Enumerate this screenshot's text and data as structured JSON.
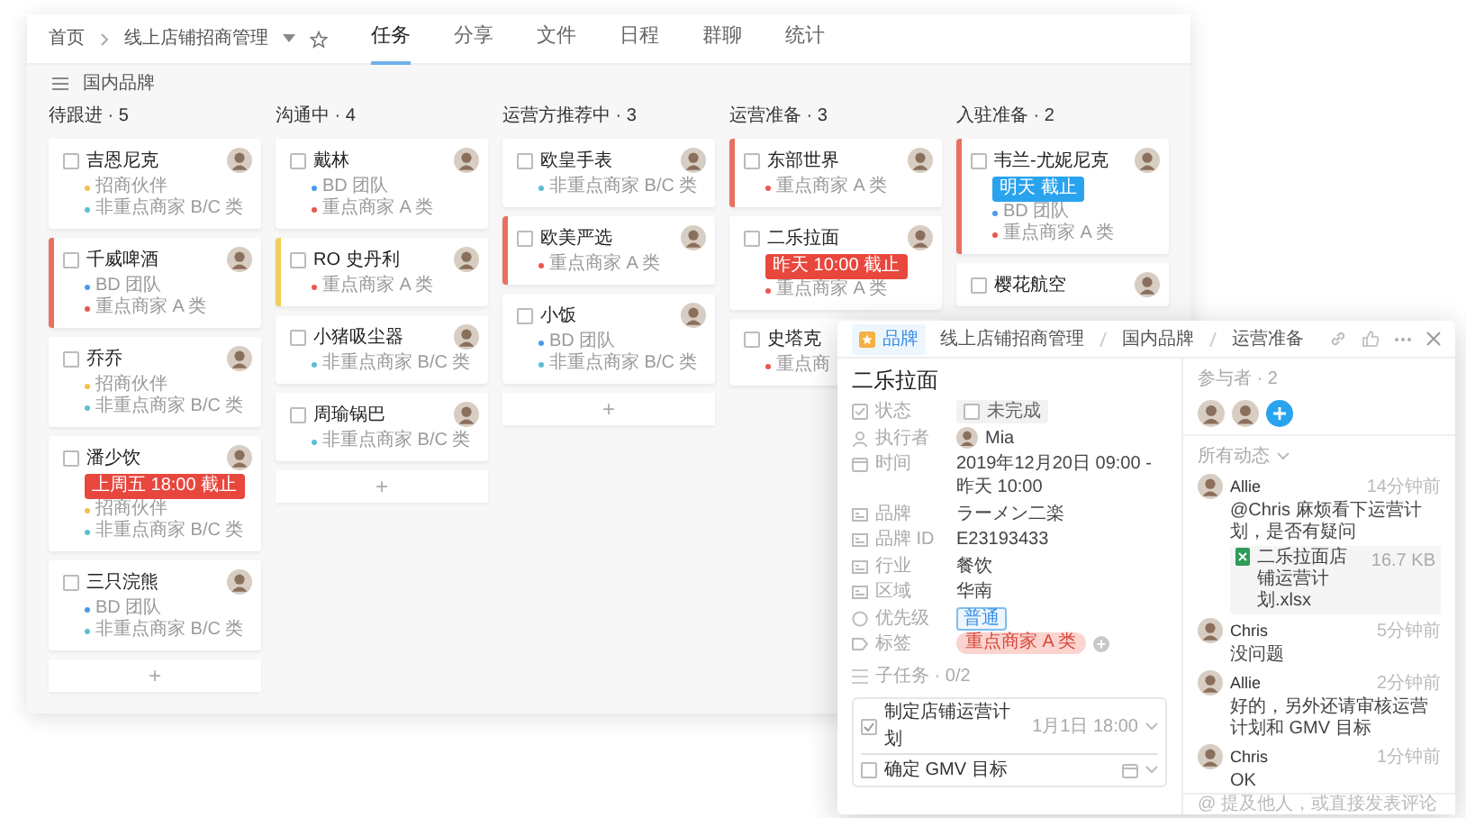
{
  "board": {
    "home": "首页",
    "project": "线上店铺招商管理",
    "tabs": [
      {
        "label": "任务",
        "selected": true
      },
      {
        "label": "分享",
        "selected": false
      },
      {
        "label": "文件",
        "selected": false
      },
      {
        "label": "日程",
        "selected": false
      },
      {
        "label": "群聊",
        "selected": false
      },
      {
        "label": "统计",
        "selected": false
      }
    ],
    "group": "国内品牌",
    "columns": [
      {
        "title": "待跟进 · 5",
        "add": "+",
        "cards": [
          {
            "title": "吉恩尼克",
            "checked": false,
            "tags": [
              {
                "text": "招商伙伴",
                "color": "#f0c24b"
              },
              {
                "text": "非重点商家 B/C 类",
                "color": "#5bbfd6"
              }
            ]
          },
          {
            "title": "千威啤酒",
            "checked": false,
            "color": "#e8705f",
            "tags": [
              {
                "text": "BD 团队",
                "color": "#4a9be8"
              },
              {
                "text": "重点商家 A 类",
                "color": "#e8584f"
              }
            ]
          },
          {
            "title": "乔乔",
            "checked": false,
            "tags": [
              {
                "text": "招商伙伴",
                "color": "#f0c24b"
              },
              {
                "text": "非重点商家 B/C 类",
                "color": "#5bbfd6"
              }
            ]
          },
          {
            "title": "潘少饮",
            "checked": false,
            "deadline": {
              "text": "上周五 18:00 截止",
              "color": "#e8473d"
            },
            "tags": [
              {
                "text": "招商伙伴",
                "color": "#f0c24b"
              },
              {
                "text": "非重点商家 B/C 类",
                "color": "#5bbfd6"
              }
            ]
          },
          {
            "title": "三只浣熊",
            "checked": false,
            "tags": [
              {
                "text": "BD 团队",
                "color": "#4a9be8"
              },
              {
                "text": "非重点商家 B/C 类",
                "color": "#5bbfd6"
              }
            ]
          }
        ]
      },
      {
        "title": "沟通中 · 4",
        "add": "+",
        "cards": [
          {
            "title": "戴林",
            "checked": false,
            "tags": [
              {
                "text": "BD 团队",
                "color": "#4a9be8"
              },
              {
                "text": "重点商家 A 类",
                "color": "#e8584f"
              }
            ]
          },
          {
            "title": "RO 史丹利",
            "checked": false,
            "color": "#f2cf5b",
            "tags": [
              {
                "text": "重点商家 A 类",
                "color": "#e8584f"
              }
            ]
          },
          {
            "title": "小猪吸尘器",
            "checked": false,
            "tags": [
              {
                "text": "非重点商家 B/C 类",
                "color": "#5bbfd6"
              }
            ]
          },
          {
            "title": "周瑜锅巴",
            "checked": false,
            "tags": [
              {
                "text": "非重点商家 B/C 类",
                "color": "#5bbfd6"
              }
            ]
          }
        ]
      },
      {
        "title": "运营方推荐中 · 3",
        "add": "+",
        "cards": [
          {
            "title": "欧皇手表",
            "checked": false,
            "tags": [
              {
                "text": "非重点商家 B/C 类",
                "color": "#5bbfd6"
              }
            ]
          },
          {
            "title": "欧美严选",
            "checked": false,
            "color": "#e8705f",
            "tags": [
              {
                "text": "重点商家 A 类",
                "color": "#e8584f"
              }
            ]
          },
          {
            "title": "小饭",
            "checked": false,
            "tags": [
              {
                "text": "BD 团队",
                "color": "#4a9be8"
              },
              {
                "text": "非重点商家 B/C 类",
                "color": "#5bbfd6"
              }
            ]
          }
        ]
      },
      {
        "title": "运营准备 · 3",
        "cards": [
          {
            "title": "东部世界",
            "checked": false,
            "color": "#e8705f",
            "tags": [
              {
                "text": "重点商家 A 类",
                "color": "#e8584f"
              }
            ]
          },
          {
            "title": "二乐拉面",
            "checked": false,
            "deadline": {
              "text": "昨天 10:00 截止",
              "color": "#e8473d"
            },
            "tags": [
              {
                "text": "重点商家 A 类",
                "color": "#e8584f"
              }
            ]
          },
          {
            "title": "史塔克",
            "checked": false,
            "avatar": false,
            "tags": [
              {
                "text": "重点商",
                "color": "#e8584f"
              }
            ]
          }
        ]
      },
      {
        "title": "入驻准备 · 2",
        "cards": [
          {
            "title": "韦兰-尤妮尼克",
            "checked": false,
            "color": "#e8705f",
            "deadline": {
              "text": "明天 截止",
              "color": "#2aa3ef"
            },
            "tags": [
              {
                "text": "BD 团队",
                "color": "#4a9be8"
              },
              {
                "text": "重点商家 A 类",
                "color": "#e8584f"
              }
            ]
          },
          {
            "title": "樱花航空",
            "checked": false
          }
        ]
      }
    ]
  },
  "detail": {
    "chip": "品牌",
    "breadcrumb": [
      "线上店铺招商管理",
      "国内品牌",
      "运营准备"
    ],
    "title": "二乐拉面",
    "fields": [
      {
        "kind": "status",
        "label": "状态",
        "value": "未完成",
        "checked": false
      },
      {
        "kind": "user",
        "label": "执行者",
        "value": "Mia"
      },
      {
        "kind": "date",
        "label": "时间",
        "value": "2019年12月20日 09:00 - 昨天 10:00"
      },
      {
        "kind": "text",
        "label": "品牌",
        "value": "ラーメン二楽"
      },
      {
        "kind": "text",
        "label": "品牌 ID",
        "value": "E23193433"
      },
      {
        "kind": "text",
        "label": "行业",
        "value": "餐饮"
      },
      {
        "kind": "text",
        "label": "区域",
        "value": "华南"
      },
      {
        "kind": "priority",
        "label": "优先级",
        "value": "普通"
      },
      {
        "kind": "tag",
        "label": "标签",
        "value": "重点商家 A 类"
      }
    ],
    "subtasks_label": "子任务 · 0/2",
    "subtasks": [
      {
        "title": "制定店铺运营计划",
        "checked": true,
        "due": "1月1日 18:00"
      },
      {
        "title": "确定 GMV 目标",
        "checked": false
      }
    ],
    "participants_label": "参与者 · 2",
    "activity_label": "所有动态",
    "comments": [
      {
        "author": "Allie",
        "time": "14分钟前",
        "text": "@Chris 麻烦看下运营计划，是否有疑问",
        "file": {
          "name": "二乐拉面店铺运营计划.xlsx",
          "size": "16.7 KB"
        }
      },
      {
        "author": "Chris",
        "time": "5分钟前",
        "text": "没问题"
      },
      {
        "author": "Allie",
        "time": "2分钟前",
        "text": "好的，另外还请审核运营计划和 GMV 目标"
      },
      {
        "author": "Chris",
        "time": "1分钟前",
        "text": "OK"
      }
    ],
    "comment_placeholder": "@ 提及他人，或直接发表评论"
  }
}
